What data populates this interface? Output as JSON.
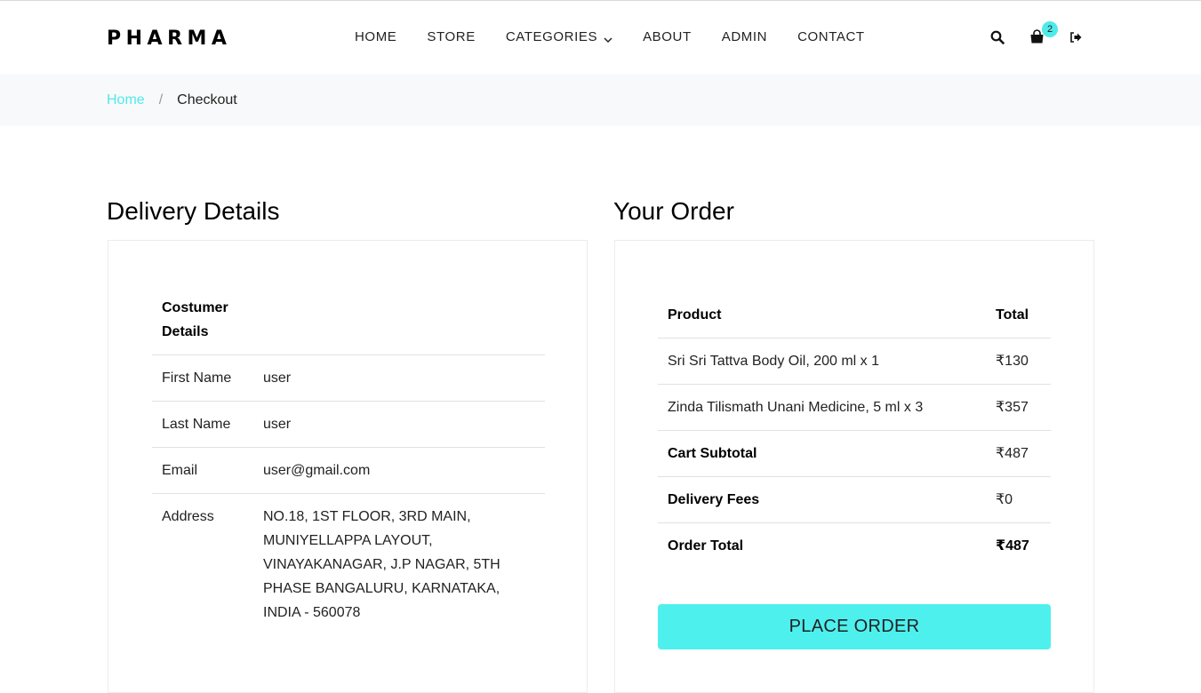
{
  "header": {
    "logo": "PHARMA",
    "nav": [
      "HOME",
      "STORE",
      "CATEGORIES",
      "ABOUT",
      "ADMIN",
      "CONTACT"
    ],
    "cart_count": "2",
    "accent_color": "#51eaea"
  },
  "breadcrumb": {
    "home": "Home",
    "separator": "/",
    "current": "Checkout"
  },
  "delivery": {
    "title": "Delivery Details",
    "header": "Costumer Details",
    "first_name_label": "First Name",
    "first_name": "user",
    "last_name_label": "Last Name",
    "last_name": "user",
    "email_label": "Email",
    "email": "user@gmail.com",
    "address_label": "Address",
    "address": "NO.18, 1ST FLOOR, 3RD MAIN, MUNIYELLAPPA LAYOUT, VINAYAKANAGAR, J.P NAGAR, 5TH PHASE BANGALURU, KARNATAKA, INDIA - 560078"
  },
  "order": {
    "title": "Your Order",
    "col_product": "Product",
    "col_total": "Total",
    "items": [
      {
        "name": "Sri Sri Tattva Body Oil, 200 ml  x  1",
        "total": "₹130"
      },
      {
        "name": "Zinda Tilismath Unani Medicine, 5 ml  x  3",
        "total": "₹357"
      }
    ],
    "subtotal_label": "Cart Subtotal",
    "subtotal": "₹487",
    "delivery_label": "Delivery Fees",
    "delivery": "₹0",
    "total_label": "Order Total",
    "total": "₹487",
    "place_order": "PLACE ORDER"
  }
}
